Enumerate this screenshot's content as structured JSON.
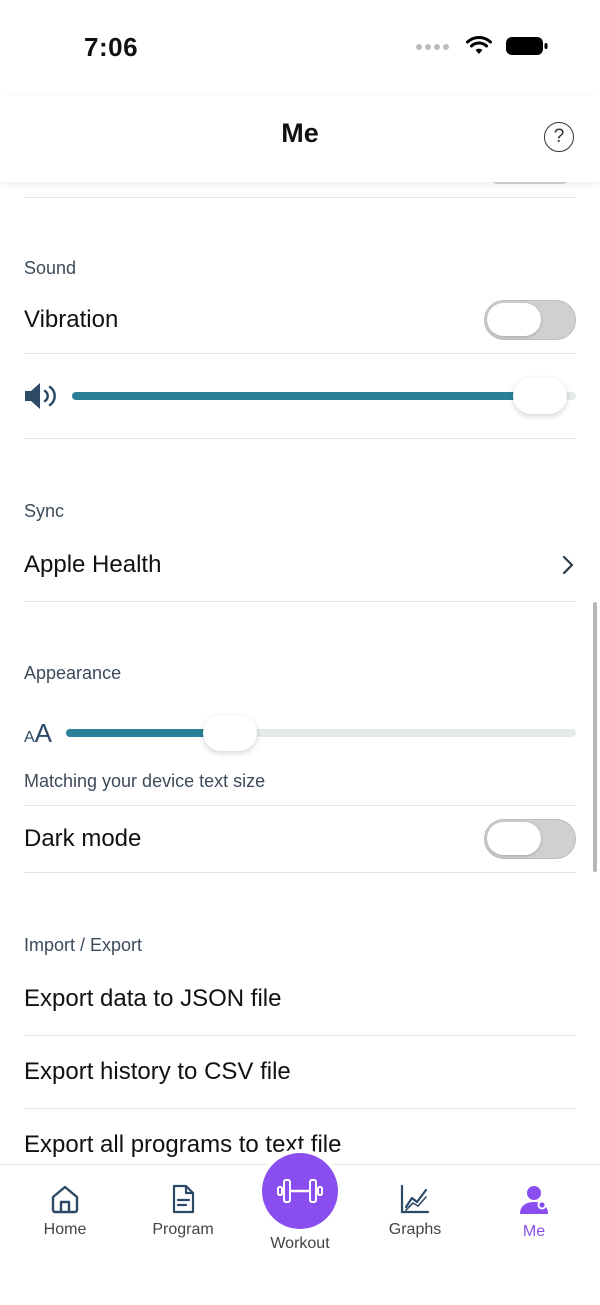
{
  "status": {
    "time": "7:06"
  },
  "header": {
    "title": "Me",
    "help_icon": "question-circle-icon",
    "help_glyph": "?"
  },
  "sound": {
    "section_label": "Sound",
    "vibration_label": "Vibration",
    "vibration_on": false,
    "volume_level": 0.98,
    "volume_icon": "speaker-icon"
  },
  "sync": {
    "section_label": "Sync",
    "apple_health_label": "Apple Health",
    "chevron_icon": "chevron-right-icon"
  },
  "appearance": {
    "section_label": "Appearance",
    "text_size_icon_small": "A",
    "text_size_icon_large": "A",
    "text_size_level": 0.3,
    "text_size_caption": "Matching your device text size",
    "dark_mode_label": "Dark mode",
    "dark_mode_on": false
  },
  "import_export": {
    "section_label": "Import / Export",
    "items": [
      {
        "label": "Export data to JSON file"
      },
      {
        "label": "Export history to CSV file"
      },
      {
        "label": "Export all programs to text file"
      }
    ]
  },
  "tabbar": {
    "home": "Home",
    "program": "Program",
    "workout": "Workout",
    "graphs": "Graphs",
    "me": "Me",
    "active_tab": "me"
  },
  "colors": {
    "accent": "#8a4ef0",
    "slider_fill": "#2c7f99",
    "section_text": "#3c4a5a",
    "toggle_off": "#d0d0d2"
  }
}
